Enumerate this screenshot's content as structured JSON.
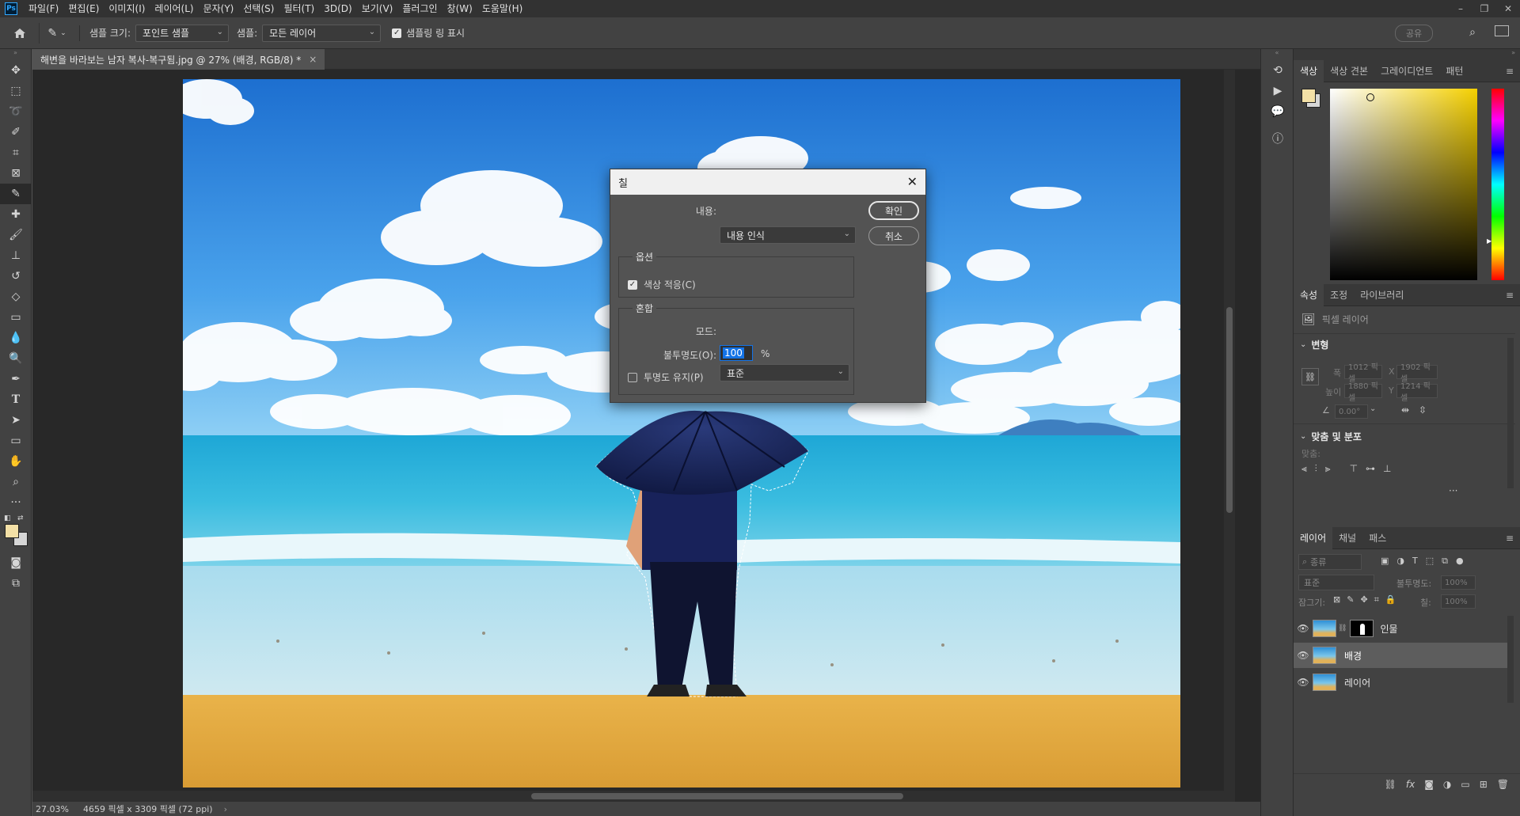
{
  "app": {
    "logo": "Ps"
  },
  "menu": [
    "파일(F)",
    "편집(E)",
    "이미지(I)",
    "레이어(L)",
    "문자(Y)",
    "선택(S)",
    "필터(T)",
    "3D(D)",
    "보기(V)",
    "플러그인",
    "창(W)",
    "도움말(H)"
  ],
  "options": {
    "sample_size_label": "샘플 크기:",
    "sample_size_value": "포인트 샘플",
    "sample_label": "샘플:",
    "sample_value": "모든 레이어",
    "ring_label": "샘플링 링 표시",
    "share": "공유"
  },
  "document": {
    "tab_title": "해변을 바라보는 남자 복사-복구됨.jpg @ 27% (배경, RGB/8) *",
    "tab_close": "×",
    "zoom": "27.03%",
    "size_info": "4659 픽셀 x 3309 픽셀 (72 ppi)"
  },
  "dialog": {
    "title": "칠",
    "content_label": "내용:",
    "content_value": "내용 인식",
    "ok": "확인",
    "cancel": "취소",
    "options_label": "옵션",
    "color_adapt_label": "색상 적응(C)",
    "blend_label": "혼합",
    "mode_label": "모드:",
    "mode_value": "표준",
    "opacity_label": "불투명도(O):",
    "opacity_value": "100",
    "opacity_unit": "%",
    "preserve_label": "투명도 유지(P)"
  },
  "color_panel": {
    "tabs": [
      "색상",
      "색상 견본",
      "그레이디언트",
      "패턴"
    ],
    "foreground": "#f3e0a6",
    "background": "#d6d6d6",
    "hue": "#f5d000"
  },
  "properties_panel": {
    "tabs": [
      "속성",
      "조정",
      "라이브러리"
    ],
    "layer_type": "픽셀 레이어",
    "transform_title": "변형",
    "w_label": "폭",
    "w_value": "1012 픽셀",
    "x_label": "X",
    "x_value": "1902 픽셀",
    "h_label": "높이",
    "h_value": "1880 픽셀",
    "y_label": "Y",
    "y_value": "1214 픽셀",
    "angle_value": "0.00°",
    "align_title": "맞춤 및 분포",
    "align_label": "맞춤:",
    "more": "···"
  },
  "layers_panel": {
    "tabs": [
      "레이어",
      "채널",
      "패스"
    ],
    "filter_label": "종류",
    "blend_mode": "표준",
    "opacity_label": "불투명도:",
    "opacity_value": "100%",
    "lock_label": "잠그기:",
    "fill_label": "칠:",
    "fill_value": "100%",
    "layers": [
      {
        "name": "인물",
        "selected": false,
        "has_mask": true
      },
      {
        "name": "배경",
        "selected": true,
        "has_mask": false
      },
      {
        "name": "레이어",
        "selected": false,
        "has_mask": false
      }
    ]
  }
}
